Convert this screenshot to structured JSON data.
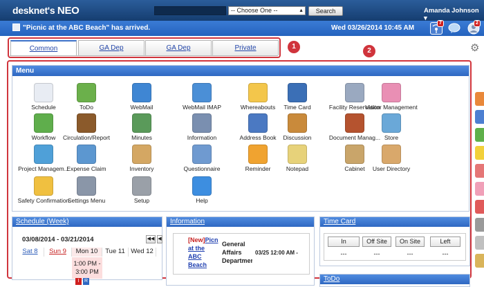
{
  "header": {
    "logo_main": "desknet's",
    "logo_neo": "NEO",
    "search_placeholder": "",
    "select_value": "-- Choose One --",
    "search_button": "Search",
    "user_name": "Amanda Johnson"
  },
  "notice": {
    "text": "\"Picnic at the ABC Beach\" has arrived.",
    "datetime": "Wed 03/26/2014 10:45 AM",
    "badges": {
      "alerts": "7",
      "messages": "2"
    }
  },
  "tabs": [
    {
      "label": "Common"
    },
    {
      "label": "GA Dep"
    },
    {
      "label": "GA Dep"
    },
    {
      "label": "Private"
    }
  ],
  "markers": {
    "one": "1",
    "two": "2"
  },
  "menu": {
    "title": "Menu",
    "items": [
      {
        "label": "Schedule",
        "icon": "calendar-icon",
        "color": "#e8ecf3"
      },
      {
        "label": "ToDo",
        "icon": "todo-icon",
        "color": "#6bb04b"
      },
      {
        "label": "WebMail",
        "icon": "webmail-icon",
        "color": "#3f86d3"
      },
      {
        "label": "WebMail IMAP",
        "icon": "webmail-imap-icon",
        "color": "#4b8fd6"
      },
      {
        "label": "Whereabouts",
        "icon": "whereabouts-icon",
        "color": "#f3c64b"
      },
      {
        "label": "Time Card",
        "icon": "timecard-icon",
        "color": "#3b6fb6"
      },
      {
        "label": "Facility Reservation",
        "icon": "facility-icon",
        "color": "#9aa9c0"
      },
      {
        "label": "Visitor Management",
        "icon": "visitor-icon",
        "color": "#e98fb4"
      },
      {
        "label": "Workflow",
        "icon": "workflow-icon",
        "color": "#5fae4c"
      },
      {
        "label": "Circulation/Report",
        "icon": "circulation-icon",
        "color": "#8b5a2b"
      },
      {
        "label": "Minutes",
        "icon": "minutes-icon",
        "color": "#5a9a5a"
      },
      {
        "label": "Information",
        "icon": "information-icon",
        "color": "#7a8fb0"
      },
      {
        "label": "Address Book",
        "icon": "addressbook-icon",
        "color": "#4b79c2"
      },
      {
        "label": "Discussion",
        "icon": "discussion-icon",
        "color": "#c98a3b"
      },
      {
        "label": "Document Manag...",
        "icon": "document-icon",
        "color": "#b5532f"
      },
      {
        "label": "Store",
        "icon": "store-icon",
        "color": "#6aa8d8"
      },
      {
        "label": "Project Managem...",
        "icon": "project-icon",
        "color": "#4fa0d8"
      },
      {
        "label": "Expense Claim",
        "icon": "expense-icon",
        "color": "#5c97d0"
      },
      {
        "label": "Inventory",
        "icon": "inventory-icon",
        "color": "#d4a763"
      },
      {
        "label": "Questionnaire",
        "icon": "questionnaire-icon",
        "color": "#6f9ad0"
      },
      {
        "label": "Reminder",
        "icon": "reminder-icon",
        "color": "#f0a330"
      },
      {
        "label": "Notepad",
        "icon": "notepad-icon",
        "color": "#e7d27a"
      },
      {
        "label": "Cabinet",
        "icon": "cabinet-icon",
        "color": "#c9a56a"
      },
      {
        "label": "User Directory",
        "icon": "user-directory-icon",
        "color": "#d9a86b"
      },
      {
        "label": "Safety Confirmation",
        "icon": "safety-icon",
        "color": "#f0c040"
      },
      {
        "label": "Settings Menu",
        "icon": "settings-menu-icon",
        "color": "#8a96a8"
      },
      {
        "label": "Setup",
        "icon": "setup-gear-icon",
        "color": "#9aa0a8"
      },
      {
        "label": "Help",
        "icon": "help-icon",
        "color": "#3d8ee0"
      }
    ]
  },
  "schedule": {
    "title": "Schedule (Week)",
    "range": "03/08/2014 - 03/21/2014",
    "days": [
      "Sat 8",
      "Sun 9",
      "Mon 10",
      "Tue 11",
      "Wed 12"
    ],
    "event_time": "1:00 PM - 3:00 PM"
  },
  "information": {
    "title": "Information",
    "new_tag": "[New]",
    "item_title": "Picnic at the ABC Beach",
    "item_title_lines": [
      "Picn",
      "at the",
      "ABC",
      "Beach"
    ],
    "dept_lines": [
      "General",
      "Affairs",
      "Departmer"
    ],
    "date": "03/25 12:00 AM -"
  },
  "timecard": {
    "title": "Time Card",
    "buttons": [
      "In",
      "Off Site",
      "On Site",
      "Left"
    ],
    "values": [
      "---",
      "---",
      "---",
      "---"
    ]
  },
  "todo": {
    "title": "ToDo"
  },
  "side_tabs": [
    "#e9883a",
    "#4d7fd1",
    "#5fb04a",
    "#f2d03a",
    "#e57676",
    "#f0a0b8",
    "#e05a5a",
    "#9a9a9a",
    "#c0c0c0",
    "#d9b45a"
  ]
}
